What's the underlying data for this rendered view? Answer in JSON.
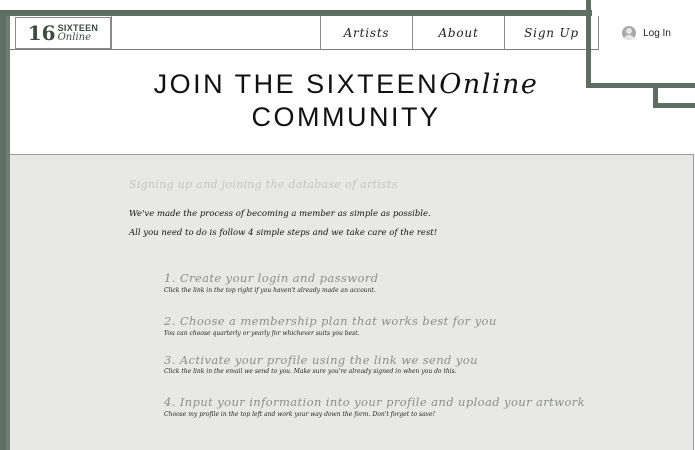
{
  "logo": {
    "number": "16",
    "top": "SIXTEEN",
    "bottom": "Online"
  },
  "nav": {
    "artists": "Artists",
    "about": "About",
    "signup": "Sign Up",
    "login": "Log In"
  },
  "title": {
    "line1_plain": "JOIN THE SIXTEEN",
    "line1_italic": "Online",
    "line2": "COMMUNITY"
  },
  "content": {
    "subheading": "Signing up and joining the database of artists",
    "intro1": "We've made the process of becoming a member as simple as possible.",
    "intro2": "All you need to do is follow 4 simple steps and we take care of the rest!",
    "steps": [
      {
        "title": "1. Create your login and password",
        "desc": "Click the link in the top right if you haven't already made an account."
      },
      {
        "title": "2. Choose a membership plan that works best for you",
        "desc": "You can choose quarterly or yearly for whichever suits you best."
      },
      {
        "title": "3. Activate your profile using the link we send you",
        "desc": "Click the link in the email we send to you. Make sure you're already signed in when you do this."
      },
      {
        "title": "4. Input your information into your profile and upload your artwork",
        "desc": "Choose my profile in the top left and work your way down the form. Don't forget to save!"
      }
    ]
  },
  "colors": {
    "frame": "#5f6e62",
    "panel": "#e8e9e6",
    "subheading": "#c2c5c0",
    "step_title": "#8b8e8b"
  }
}
